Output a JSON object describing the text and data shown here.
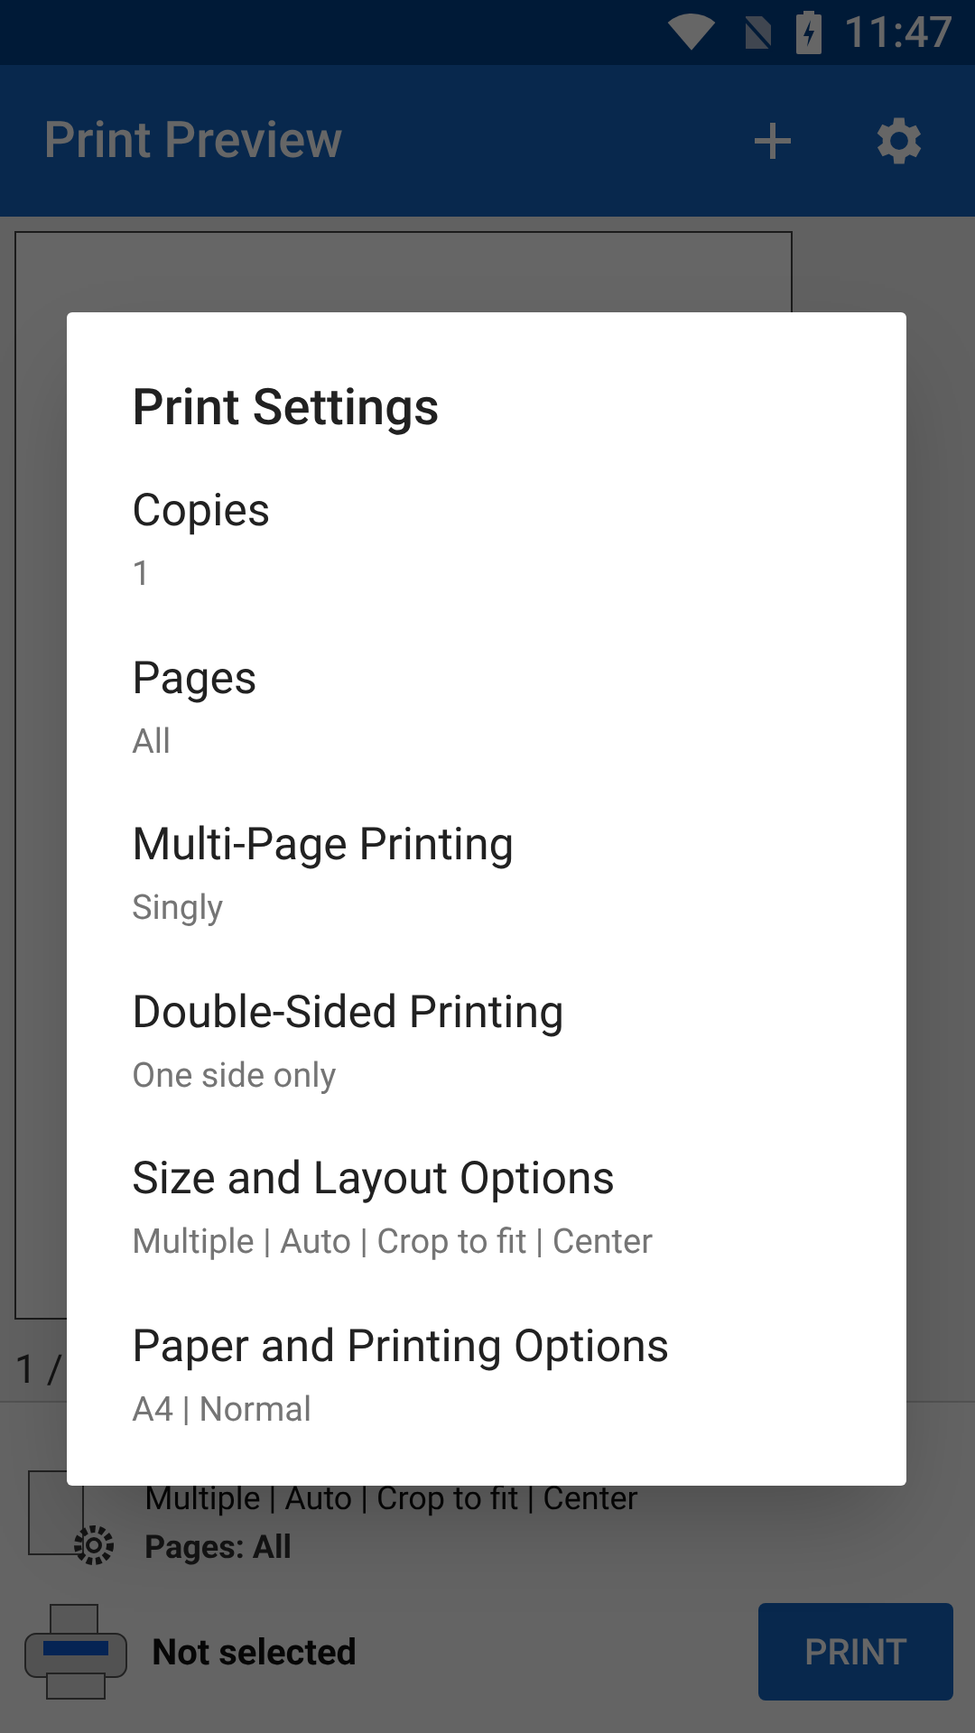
{
  "status_bar": {
    "time": "11:47"
  },
  "app_bar": {
    "title": "Print Preview"
  },
  "preview": {
    "page_indicator": "1 /"
  },
  "summary": {
    "lines": [
      "Multiple | Auto | Crop to fit | Center",
      "Pages: All"
    ]
  },
  "printer": {
    "name": "Not selected",
    "button": "PRINT"
  },
  "dialog": {
    "title": "Print Settings",
    "items": [
      {
        "label": "Copies",
        "value": "1"
      },
      {
        "label": "Pages",
        "value": "All"
      },
      {
        "label": "Multi-Page Printing",
        "value": "Singly"
      },
      {
        "label": "Double-Sided Printing",
        "value": "One side only"
      },
      {
        "label": "Size and Layout Options",
        "value": "Multiple | Auto | Crop to fit | Center"
      },
      {
        "label": "Paper and Printing Options",
        "value": "A4 | Normal"
      }
    ]
  }
}
